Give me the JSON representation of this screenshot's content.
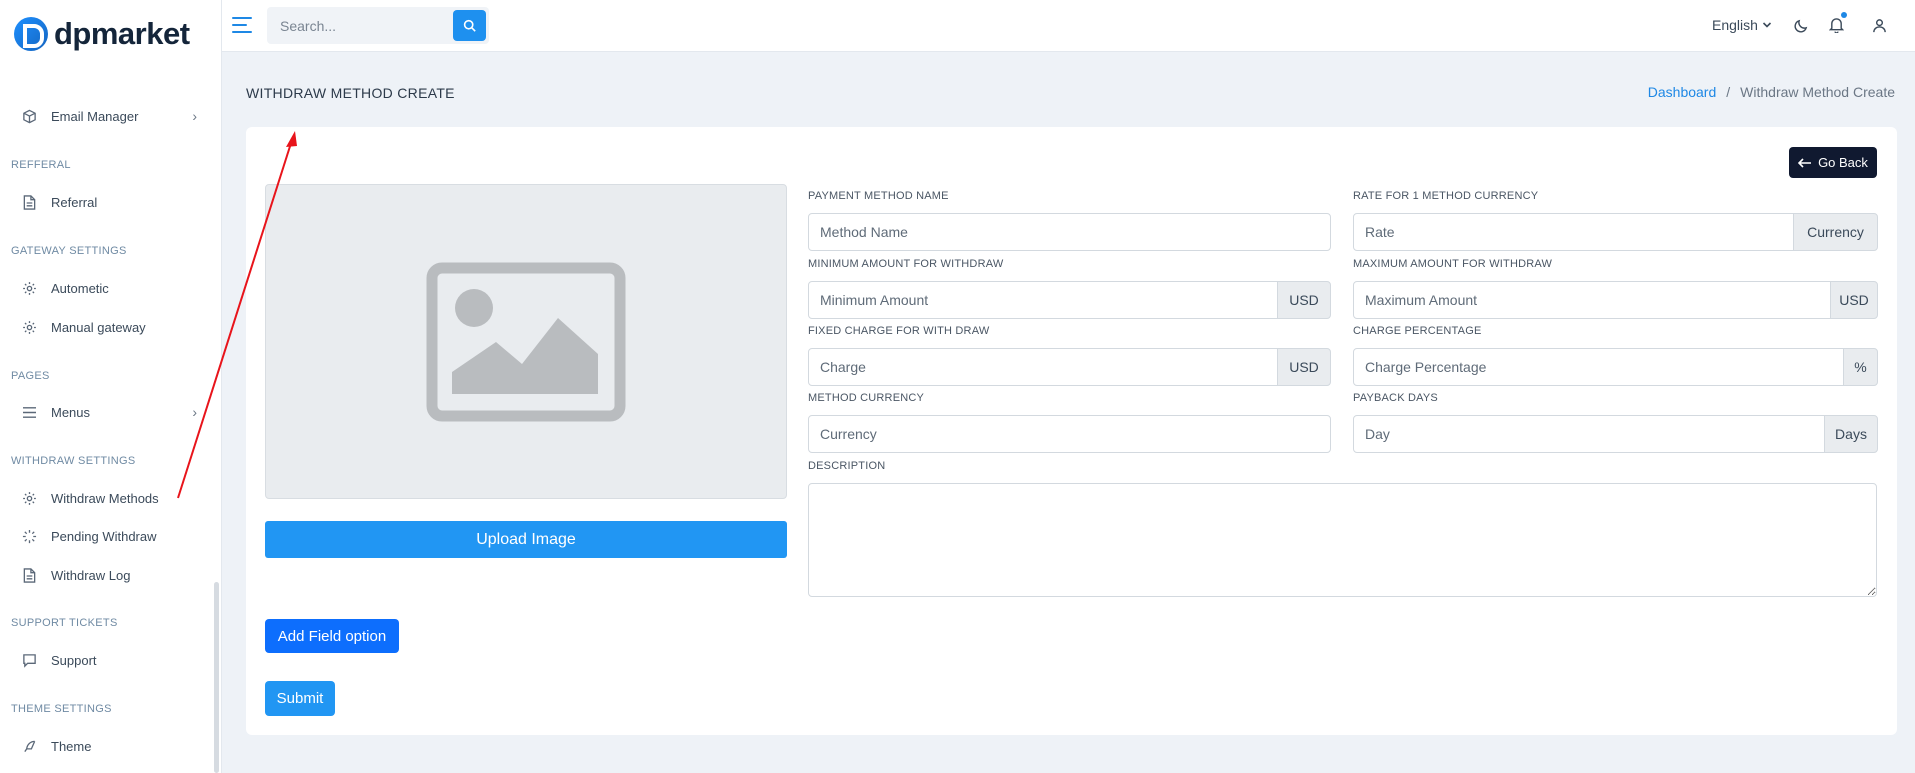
{
  "brand": {
    "name": "dpmarket"
  },
  "sidebar": {
    "items": [
      {
        "label": "Email Manager"
      },
      {
        "section": "REFFERAL"
      },
      {
        "label": "Referral"
      },
      {
        "section": "GATEWAY SETTINGS"
      },
      {
        "label": "Autometic"
      },
      {
        "label": "Manual gateway"
      },
      {
        "section": "PAGES"
      },
      {
        "label": "Menus"
      },
      {
        "section": "WITHDRAW SETTINGS"
      },
      {
        "label": "Withdraw Methods"
      },
      {
        "label": "Pending Withdraw"
      },
      {
        "label": "Withdraw Log"
      },
      {
        "section": "SUPPORT TICKETS"
      },
      {
        "label": "Support"
      },
      {
        "section": "THEME SETTINGS"
      },
      {
        "label": "Theme"
      }
    ]
  },
  "topbar": {
    "search_placeholder": "Search...",
    "language": "English"
  },
  "page": {
    "title": "WITHDRAW METHOD CREATE",
    "breadcrumb": [
      "Dashboard",
      "/",
      "Withdraw Method Create"
    ]
  },
  "form": {
    "go_back": "Go Back",
    "upload_image": "Upload Image",
    "fields": {
      "method_name": {
        "label": "PAYMENT METHOD NAME",
        "placeholder": "Method Name"
      },
      "rate": {
        "label": "RATE FOR 1 METHOD CURRENCY",
        "placeholder": "Rate",
        "addon": "Currency"
      },
      "min_amount": {
        "label": "MINIMUM AMOUNT FOR WITHDRAW",
        "placeholder": "Minimum Amount",
        "addon": "USD"
      },
      "max_amount": {
        "label": "MAXIMUM AMOUNT FOR WITHDRAW",
        "placeholder": "Maximum Amount",
        "addon": "USD"
      },
      "fixed_charge": {
        "label": "FIXED CHARGE FOR WITH DRAW",
        "placeholder": "Charge",
        "addon": "USD"
      },
      "charge_pct": {
        "label": "CHARGE PERCENTAGE",
        "placeholder": "Charge Percentage",
        "addon": "%"
      },
      "method_currency": {
        "label": "METHOD CURRENCY",
        "placeholder": "Currency"
      },
      "payback_days": {
        "label": "PAYBACK DAYS",
        "placeholder": "Day",
        "addon": "Days"
      },
      "description": {
        "label": "DESCRIPTION"
      }
    },
    "add_field": "Add Field option",
    "submit": "Submit"
  },
  "colors": {
    "primary": "#2196f3",
    "dark_button": "#101930",
    "annotation_arrow": "#e8141b"
  }
}
